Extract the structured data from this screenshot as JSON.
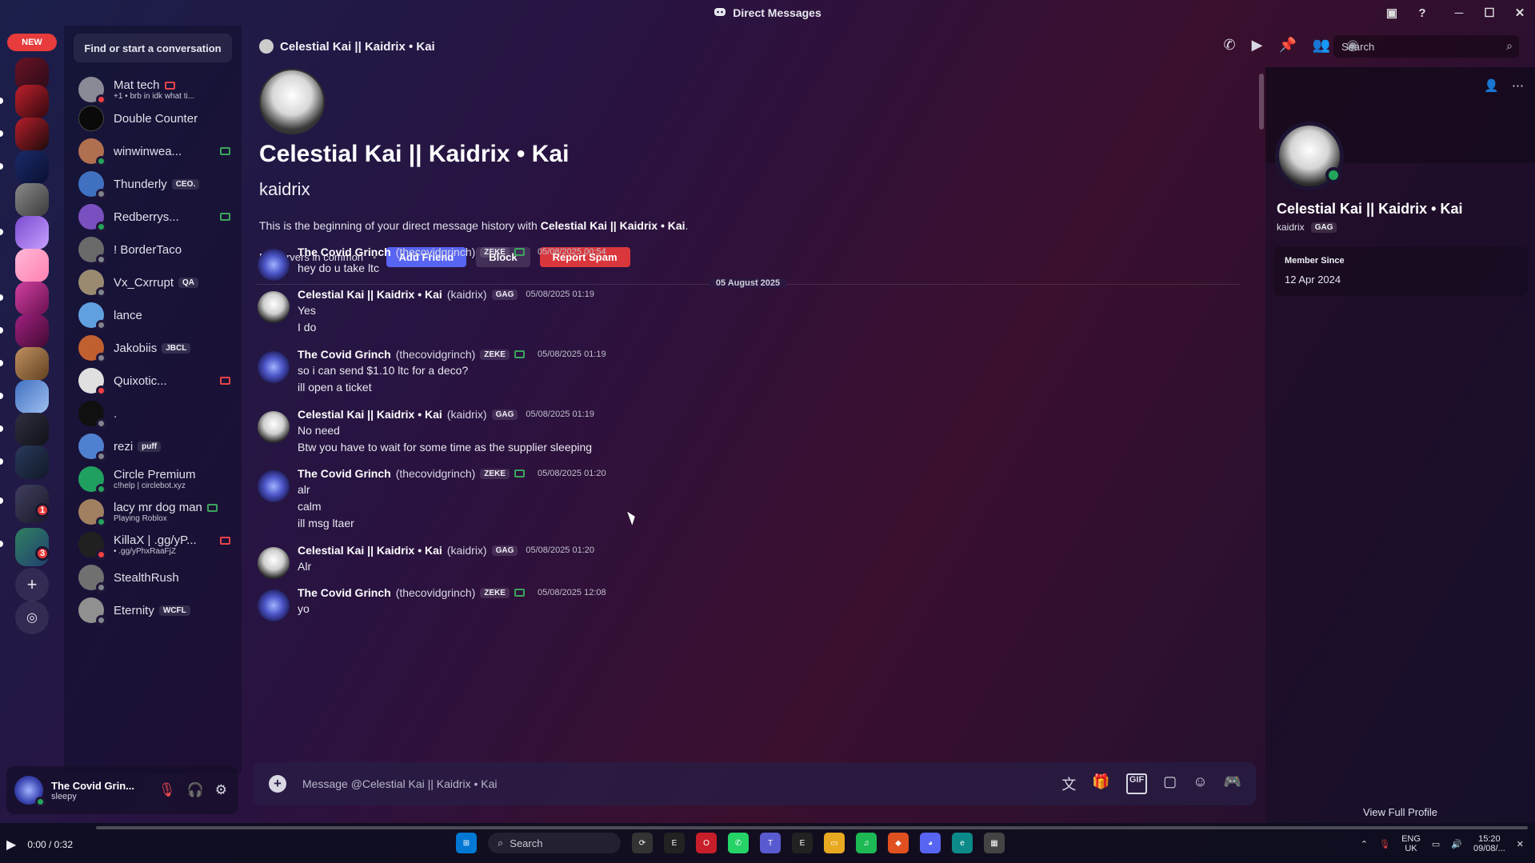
{
  "window": {
    "title": "Direct Messages"
  },
  "rail": {
    "new_badge": "NEW",
    "badge_a": "1",
    "badge_b": "3"
  },
  "dm_list": {
    "search_label": "Find or start a conversation",
    "items": [
      {
        "name": "Mat tech",
        "sub": "+1 • brb in idk what ti..."
      },
      {
        "name": "Double Counter",
        "sub": ""
      },
      {
        "name": "winwinwea...",
        "sub": ""
      },
      {
        "name": "Thunderly",
        "tag": "CEO.",
        "sub": ""
      },
      {
        "name": "Redberrys...",
        "sub": ""
      },
      {
        "name": "! BorderTaco",
        "sub": ""
      },
      {
        "name": "Vx_Cxrrupt",
        "tag": "QA",
        "sub": ""
      },
      {
        "name": "lance",
        "sub": ""
      },
      {
        "name": "Jakobiis",
        "tag": "JBCL",
        "sub": ""
      },
      {
        "name": "Quixotic...",
        "sub": ""
      },
      {
        "name": ".",
        "sub": ""
      },
      {
        "name": "rezi",
        "tag": "puff",
        "sub": ""
      },
      {
        "name": "Circle Premium",
        "sub": "c!help | circlebot.xyz"
      },
      {
        "name": "lacy mr dog man",
        "sub": "Playing Roblox"
      },
      {
        "name": "KillaX | .gg/yP...",
        "sub": "• .gg/yPhxRaaFjZ"
      },
      {
        "name": "StealthRush",
        "sub": ""
      },
      {
        "name": "Eternity",
        "tag": "WCFL",
        "sub": ""
      }
    ]
  },
  "user_panel": {
    "name": "The Covid Grin...",
    "status": "sleepy"
  },
  "header": {
    "title": "Celestial Kai || Kaidrix • Kai",
    "search_placeholder": "Search"
  },
  "intro": {
    "display_name": "Celestial Kai || Kaidrix • Kai",
    "username": "kaidrix",
    "text_prefix": "This is the beginning of your direct message history with ",
    "text_name": "Celestial Kai || Kaidrix • Kai",
    "text_suffix": ".",
    "mutual": "No servers in common",
    "add_friend": "Add Friend",
    "block": "Block",
    "report": "Report Spam"
  },
  "date_divider": "05 August 2025",
  "messages": [
    {
      "author": "The Covid Grinch",
      "handle": "(thecovidgrinch)",
      "tag": "ZEKE",
      "time": "05/08/2025 00:54",
      "lines": [
        "hey do u take ltc"
      ]
    },
    {
      "author": "Celestial Kai || Kaidrix • Kai",
      "handle": "(kaidrix)",
      "tag": "GAG",
      "time": "05/08/2025 01:19",
      "lines": [
        "Yes",
        "I do"
      ]
    },
    {
      "author": "The Covid Grinch",
      "handle": "(thecovidgrinch)",
      "tag": "ZEKE",
      "time": "05/08/2025 01:19",
      "lines": [
        "so i can send $1.10 ltc for a deco?",
        "ill open a ticket"
      ]
    },
    {
      "author": "Celestial Kai || Kaidrix • Kai",
      "handle": "(kaidrix)",
      "tag": "GAG",
      "time": "05/08/2025 01:19",
      "lines": [
        "No need",
        "Btw you have to wait for some time as the supplier sleeping"
      ]
    },
    {
      "author": "The Covid Grinch",
      "handle": "(thecovidgrinch)",
      "tag": "ZEKE",
      "time": "05/08/2025 01:20",
      "lines": [
        "alr",
        "calm",
        "ill msg ltaer"
      ]
    },
    {
      "author": "Celestial Kai || Kaidrix • Kai",
      "handle": "(kaidrix)",
      "tag": "GAG",
      "time": "05/08/2025 01:20",
      "lines": [
        "Alr"
      ]
    },
    {
      "author": "The Covid Grinch",
      "handle": "(thecovidgrinch)",
      "tag": "ZEKE",
      "time": "05/08/2025 12:08",
      "lines": [
        "yo"
      ]
    }
  ],
  "composer": {
    "placeholder": "Message @Celestial Kai || Kaidrix • Kai"
  },
  "profile": {
    "display_name": "Celestial Kai || Kaidrix • Kai",
    "username": "kaidrix",
    "tag": "GAG",
    "member_since_label": "Member Since",
    "member_since": "12 Apr 2024",
    "view_full": "View Full Profile"
  },
  "video": {
    "time": "0:00 / 0:32",
    "progress": 0.0
  },
  "taskbar": {
    "search": "Search",
    "lang_top": "ENG",
    "lang_bottom": "UK",
    "clock_time": "15:20",
    "clock_date": "09/08/..."
  },
  "colors": {
    "accent": "#5865f2",
    "danger": "#da373c",
    "online": "#23a55a"
  }
}
